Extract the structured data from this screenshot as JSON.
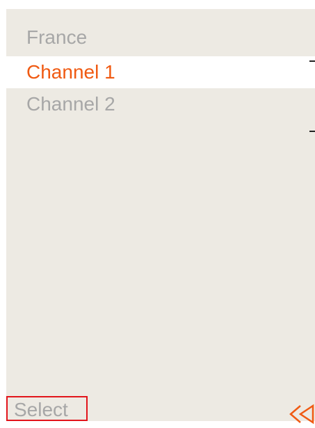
{
  "menu": {
    "items": [
      {
        "label": "France",
        "selected": false
      },
      {
        "label": "Channel 1",
        "selected": true
      },
      {
        "label": "Channel 2",
        "selected": false
      }
    ]
  },
  "softkeys": {
    "left_label": "Select",
    "right_icon": "double-back-arrow-icon"
  },
  "colors": {
    "background": "#edeae3",
    "selected_row": "#ffffff",
    "selected_text": "#f05a12",
    "normal_text": "#a7a7a7",
    "focus_border": "#e2141b"
  }
}
